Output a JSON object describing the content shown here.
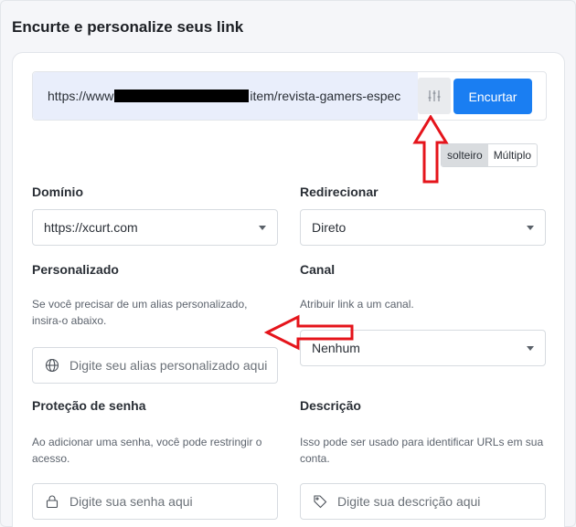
{
  "page": {
    "title": "Encurte e personalize seus link"
  },
  "url_bar": {
    "url_prefix": "https://www",
    "url_suffix": "item/revista-gamers-espec",
    "shorten_label": "Encurtar",
    "settings_icon": "sliders-icon"
  },
  "mode_toggle": {
    "single_label": "solteiro",
    "multiple_label": "Múltiplo",
    "selected": "solteiro"
  },
  "domain": {
    "label": "Domínio",
    "value": "https://xcurt.com"
  },
  "redirect": {
    "label": "Redirecionar",
    "value": "Direto"
  },
  "custom": {
    "label": "Personalizado",
    "help": "Se você precisar de um alias personalizado, insira-o abaixo.",
    "placeholder": "Digite seu alias personalizado aqui",
    "icon": "globe-icon"
  },
  "channel": {
    "label": "Canal",
    "help": "Atribuir link a um canal.",
    "value": "Nenhum"
  },
  "password": {
    "label": "Proteção de senha",
    "help": "Ao adicionar uma senha, você pode restringir o acesso.",
    "placeholder": "Digite sua senha aqui",
    "icon": "lock-icon"
  },
  "description": {
    "label": "Descrição",
    "help": "Isso pode ser usado para identificar URLs em sua conta.",
    "placeholder": "Digite sua descrição aqui",
    "icon": "tag-icon"
  },
  "colors": {
    "accent": "#1a7ef2",
    "annotation": "#e5141b"
  }
}
